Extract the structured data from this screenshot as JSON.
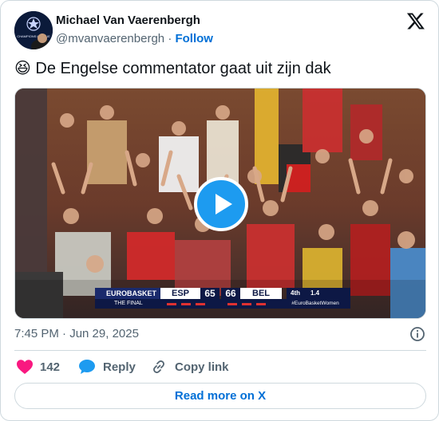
{
  "author": {
    "name": "Michael Van Vaerenbergh",
    "handle": "@mvanvaerenbergh",
    "separator": "·",
    "follow_label": "Follow"
  },
  "avatar": {
    "caption": "CHAMPIONS LEAGUE"
  },
  "tweet": {
    "emoji": "😆",
    "text": "De Engelse commentator gaat uit zijn dak"
  },
  "video": {
    "scorebug": {
      "brand": "EUROBASKET",
      "subtitle": "THE FINAL",
      "team1": "ESP",
      "score1": "65",
      "score2": "66",
      "team2": "BEL",
      "period": "4th",
      "clock": "1.4",
      "hashtag": "#EuroBasketWomen"
    }
  },
  "timestamp": "7:45 PM · Jun 29, 2025",
  "actions": {
    "like_count": "142",
    "reply_label": "Reply",
    "copy_label": "Copy link"
  },
  "read_more_label": "Read more on X",
  "colors": {
    "accent": "#1d9bf0",
    "link": "#006fd6",
    "like": "#f91880",
    "muted": "#536471",
    "border": "#cfd9de"
  }
}
